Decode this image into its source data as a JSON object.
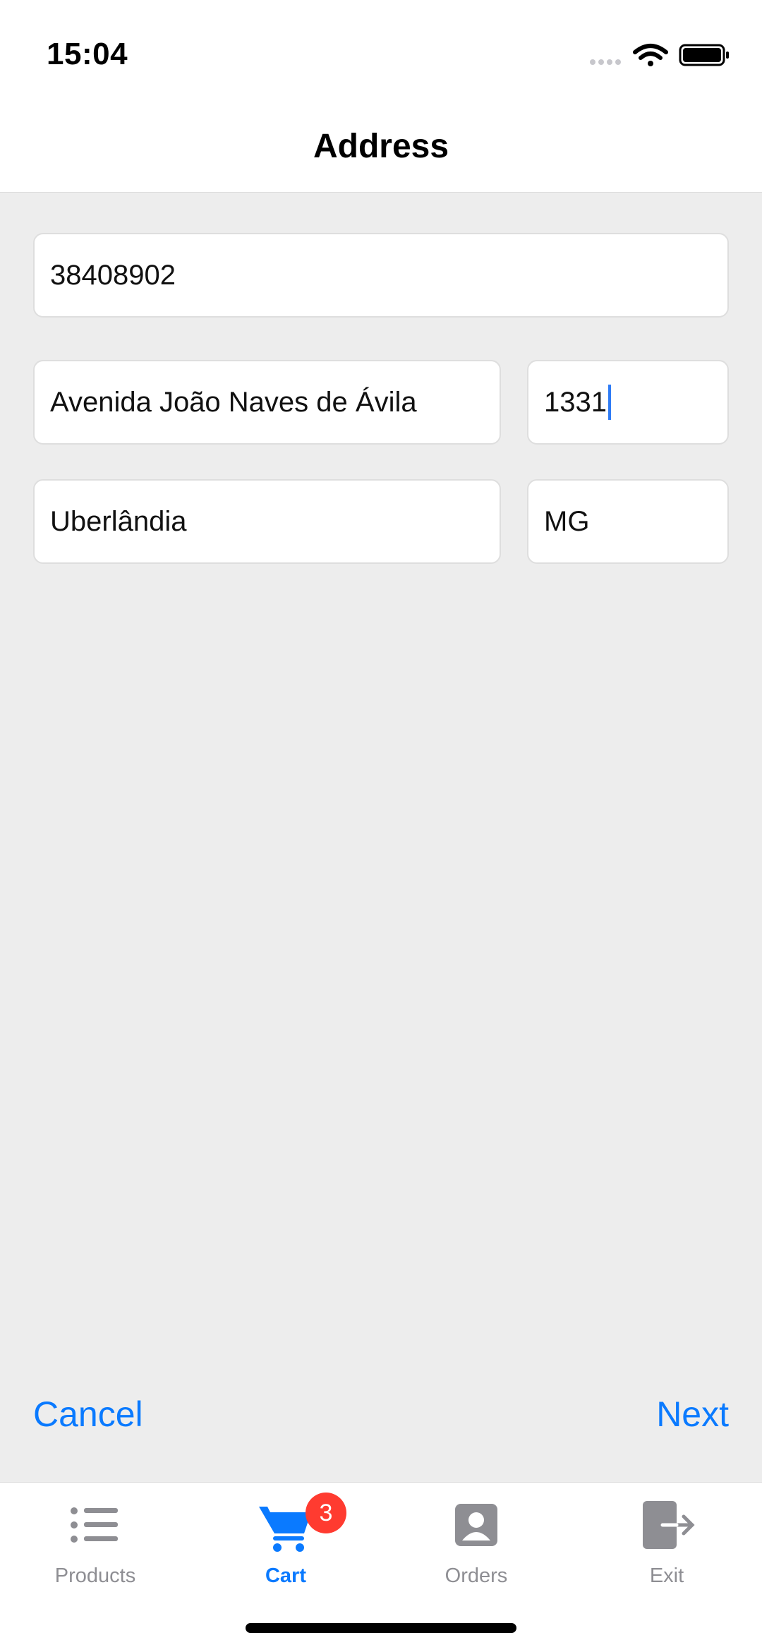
{
  "status_bar": {
    "time": "15:04",
    "icons": [
      "signal-icon",
      "wifi-icon",
      "battery-icon"
    ]
  },
  "nav": {
    "title": "Address"
  },
  "form": {
    "zip": "38408902",
    "street": "Avenida João Naves de Ávila",
    "number": "1331",
    "city": "Uberlândia",
    "state": "MG"
  },
  "actions": {
    "cancel": "Cancel",
    "next": "Next"
  },
  "tabs": [
    {
      "label": "Products",
      "icon": "list-icon",
      "active": false
    },
    {
      "label": "Cart",
      "icon": "cart-icon",
      "active": true,
      "badge": "3"
    },
    {
      "label": "Orders",
      "icon": "person-icon",
      "active": false
    },
    {
      "label": "Exit",
      "icon": "exit-icon",
      "active": false
    }
  ],
  "colors": {
    "accent": "#0a7aff",
    "badge": "#ff3b30",
    "background": "#ededed",
    "inactive": "#8e8e93"
  }
}
